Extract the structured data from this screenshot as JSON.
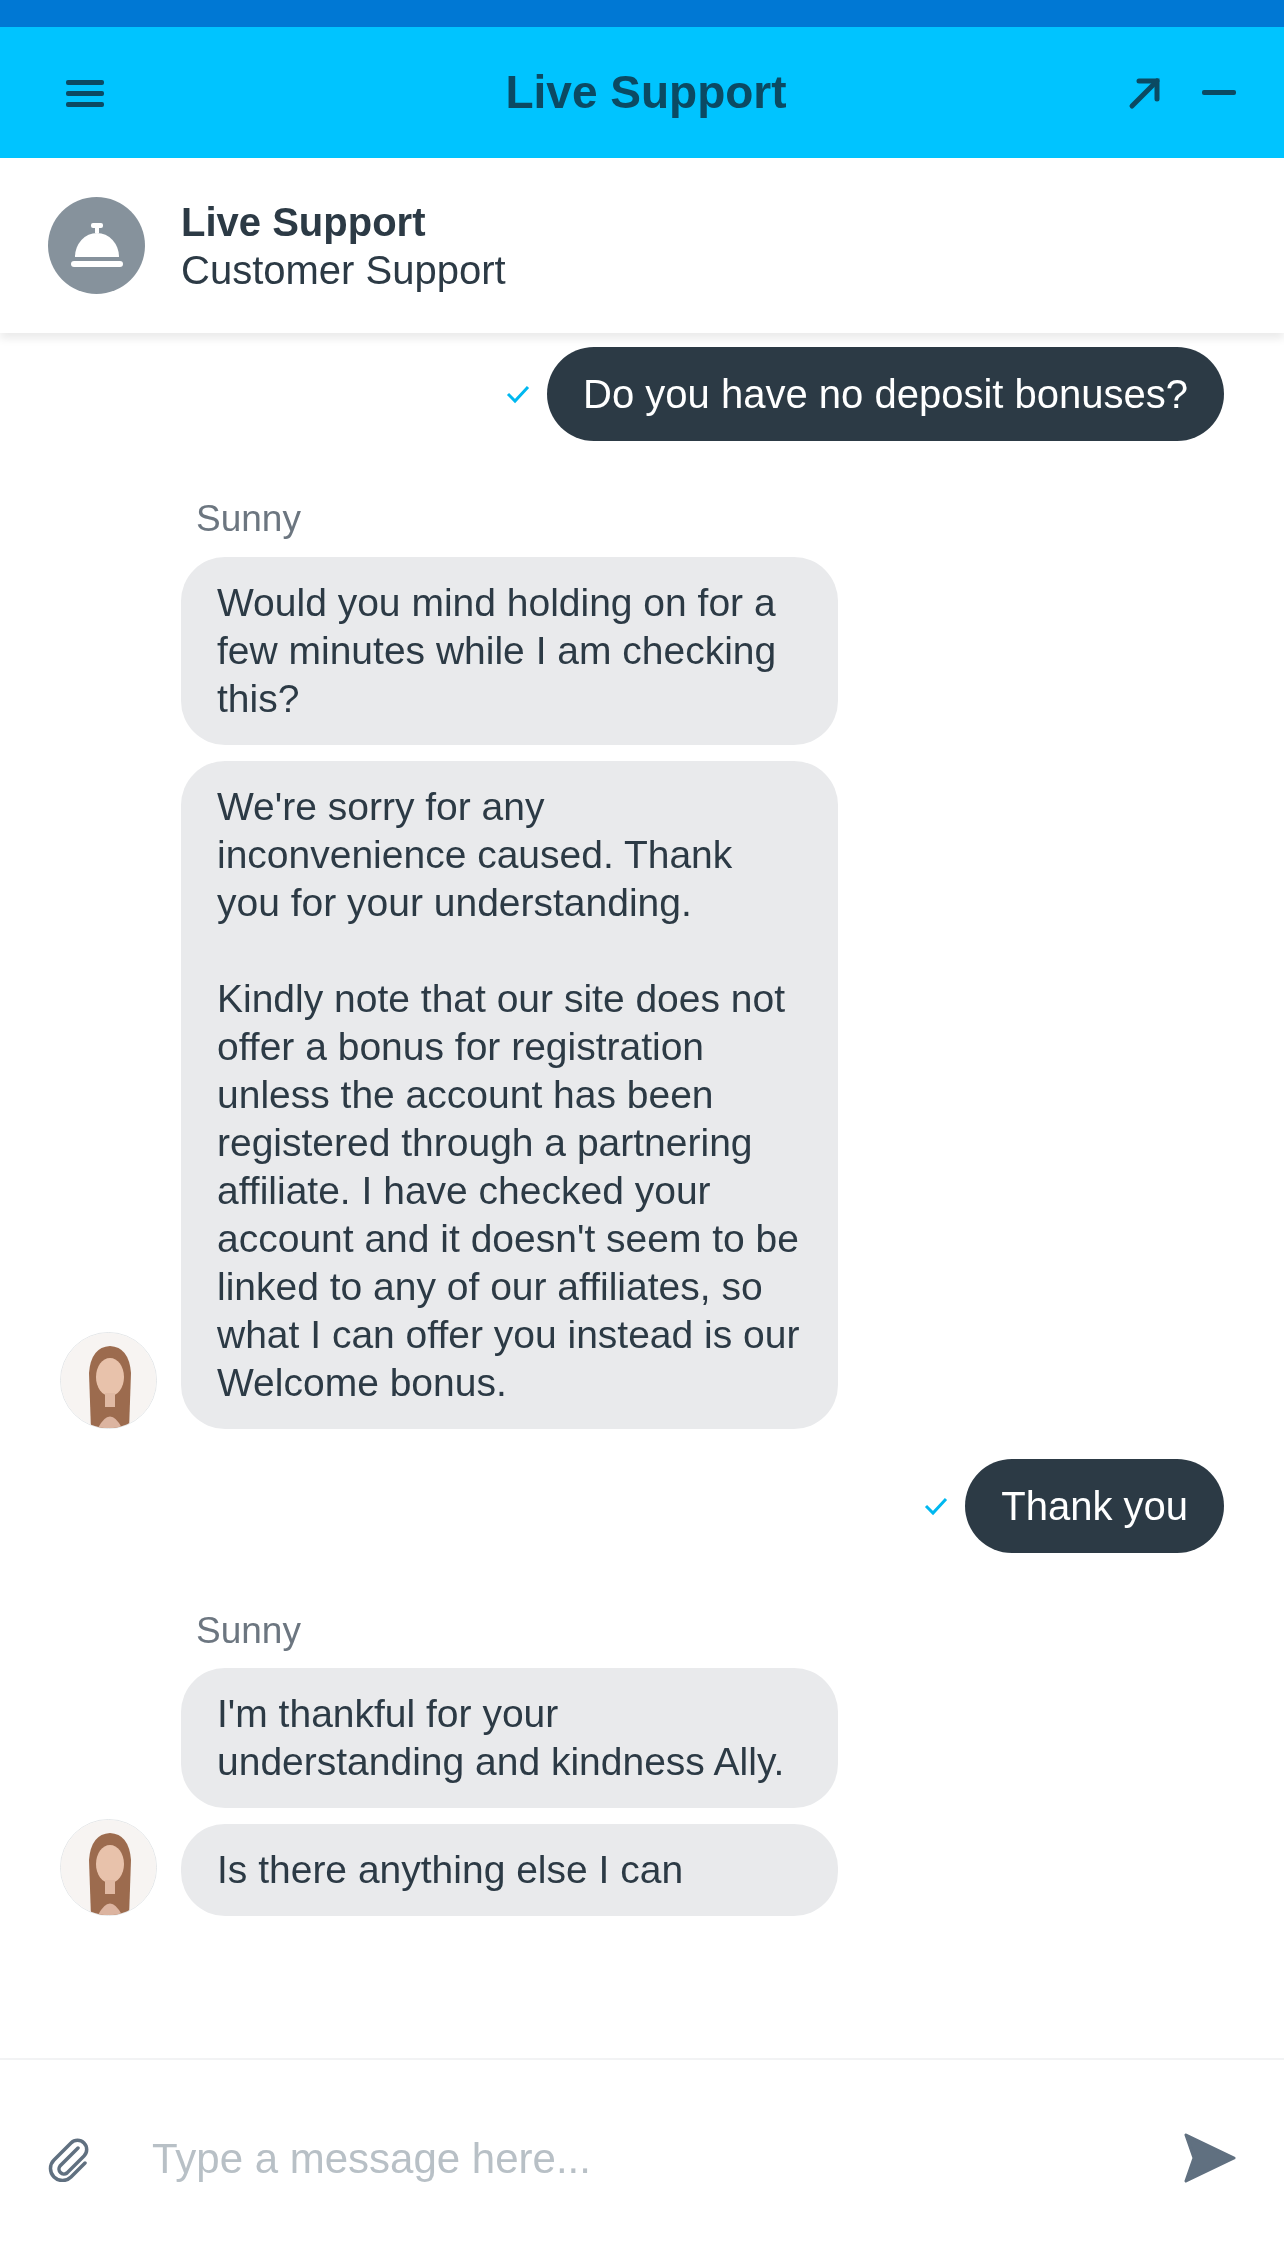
{
  "header": {
    "title": "Live Support"
  },
  "agent_info": {
    "name": "Live Support",
    "role": "Customer Support"
  },
  "messages": [
    {
      "kind": "visitor",
      "text": "Do you have no deposit bonuses?",
      "delivered": true
    },
    {
      "kind": "agent_group",
      "sender": "Sunny",
      "avatar": true,
      "bubbles": [
        "Would you mind holding on for a few minutes while I am checking this?",
        "We're sorry for any inconvenience caused. Thank you for your understanding.\n\nKindly note that our site does not offer a bonus for registration unless the account has been registered through a partnering affiliate. I have checked your account and it doesn't seem to be linked to any of our affiliates, so what I can offer you instead is our Welcome bonus."
      ]
    },
    {
      "kind": "visitor",
      "text": "Thank you",
      "delivered": true
    },
    {
      "kind": "agent_group",
      "sender": "Sunny",
      "avatar": true,
      "bubbles": [
        "I'm thankful for your understanding and kindness Ally.",
        "Is there anything else I can"
      ]
    }
  ],
  "composer": {
    "placeholder": "Type a message here..."
  }
}
